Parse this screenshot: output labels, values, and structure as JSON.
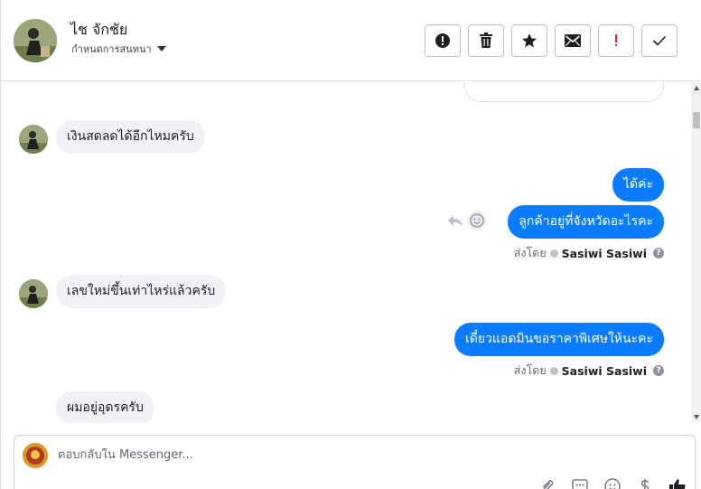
{
  "header": {
    "contact_name": "ไช จักชัย",
    "assign_label": "กำหนดการสนทนา"
  },
  "actions": [
    {
      "name": "spam-button",
      "icon": "alert-circle-icon"
    },
    {
      "name": "delete-button",
      "icon": "trash-icon"
    },
    {
      "name": "star-button",
      "icon": "star-icon"
    },
    {
      "name": "mark-unread-button",
      "icon": "envelope-icon"
    },
    {
      "name": "follow-up-button",
      "icon": "exclamation-icon"
    },
    {
      "name": "mark-done-button",
      "icon": "check-icon"
    }
  ],
  "messages": {
    "m1": "เงินสดลดได้อีกไหมครับ",
    "m2": "ได้ค่ะ",
    "m3": "ลูกค้าอยู่ที่จังหวัดอะไรคะ",
    "m4": "เลขใหม่ขึ้นเท่าไหร่แล้วครับ",
    "m5": "เดี๋ยวแอดมินขอราคาพิเศษให้นะคะ",
    "m6": "ผมอยู่อุดรครับ"
  },
  "sent_by": {
    "prefix": "ส่งโดย",
    "name": "Sasiwi Sasiwi",
    "help": "?"
  },
  "composer": {
    "placeholder": "ตอบกลับใน Messenger..."
  },
  "colors": {
    "outgoing": "#0a7cff",
    "incoming": "#f0f2f5",
    "follow_up": "#e41e3f"
  }
}
